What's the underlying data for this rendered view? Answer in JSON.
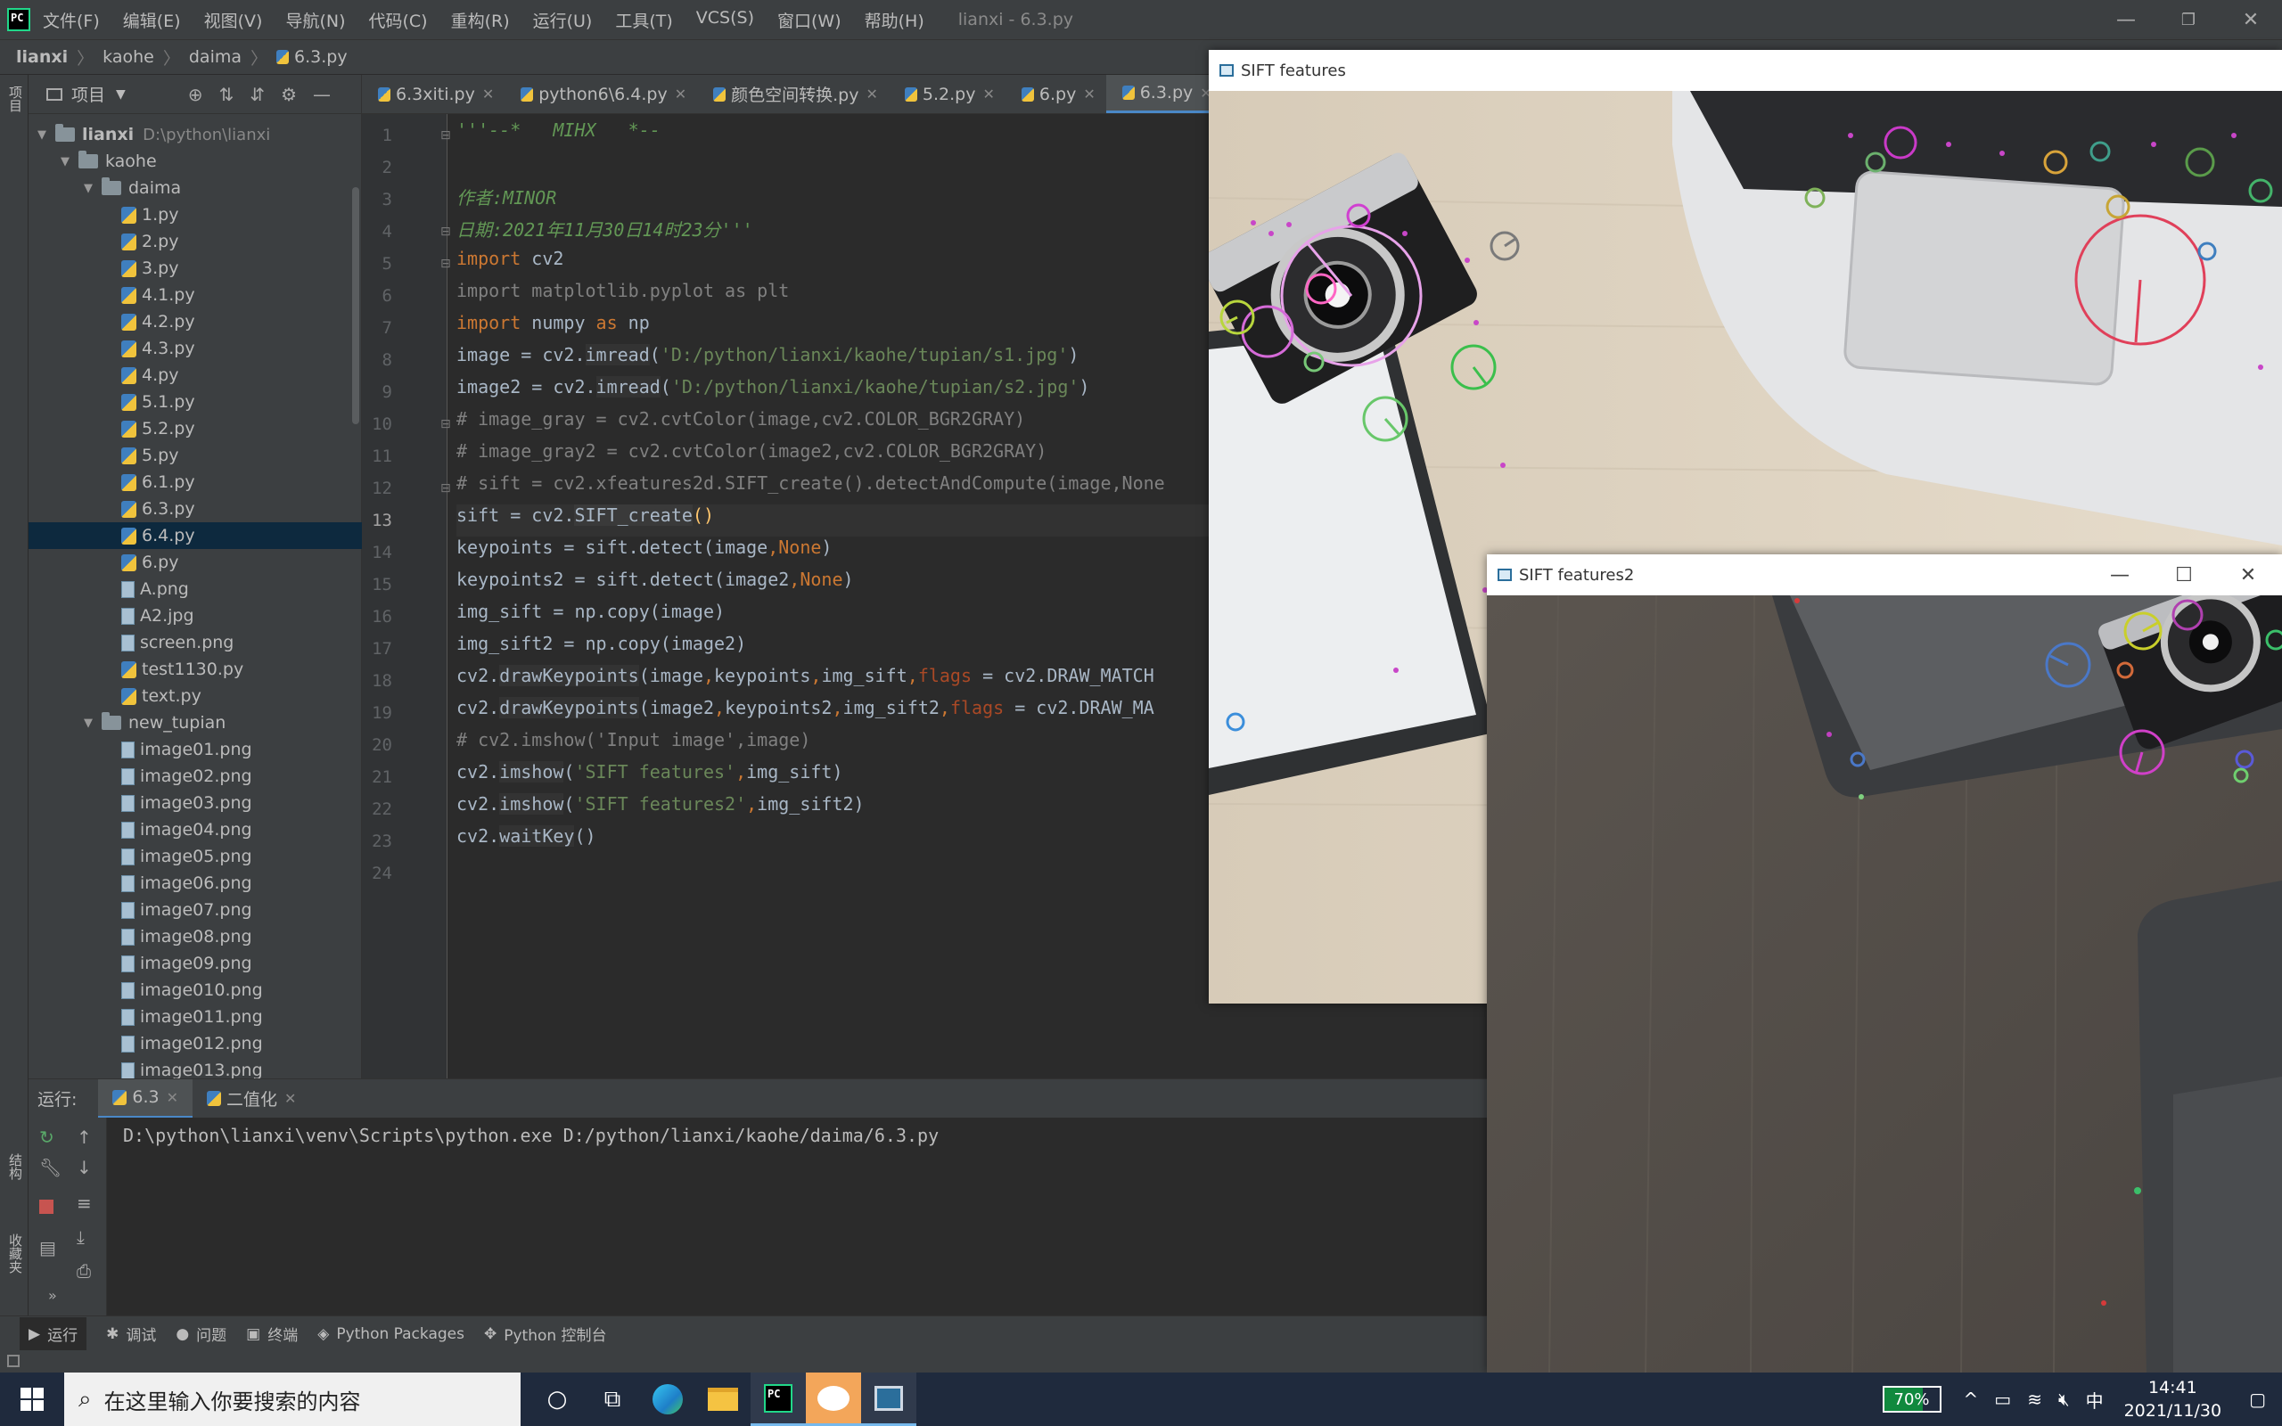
{
  "titlebar": {
    "menus": [
      "文件(F)",
      "编辑(E)",
      "视图(V)",
      "导航(N)",
      "代码(C)",
      "重构(R)",
      "运行(U)",
      "工具(T)",
      "VCS(S)",
      "窗口(W)",
      "帮助(H)"
    ],
    "title": "lianxi - 6.3.py",
    "minimize": "—",
    "maximize": "❐",
    "close": "✕"
  },
  "breadcrumb": [
    "lianxi",
    "kaohe",
    "daima",
    "6.3.py"
  ],
  "left_strip": {
    "project_label": "项目",
    "structure_label": "结构",
    "favorites_label": "收藏夹"
  },
  "project_panel": {
    "title": "项目",
    "root": "lianxi",
    "root_path": "D:\\python\\lianxi",
    "tree": [
      {
        "label": "lianxi",
        "depth": 0,
        "kind": "folder",
        "open": true
      },
      {
        "label": "kaohe",
        "depth": 1,
        "kind": "folder",
        "open": true
      },
      {
        "label": "daima",
        "depth": 2,
        "kind": "folder",
        "open": true
      },
      {
        "label": "1.py",
        "depth": 3,
        "kind": "py"
      },
      {
        "label": "2.py",
        "depth": 3,
        "kind": "py"
      },
      {
        "label": "3.py",
        "depth": 3,
        "kind": "py"
      },
      {
        "label": "4.1.py",
        "depth": 3,
        "kind": "py"
      },
      {
        "label": "4.2.py",
        "depth": 3,
        "kind": "py"
      },
      {
        "label": "4.3.py",
        "depth": 3,
        "kind": "py"
      },
      {
        "label": "4.py",
        "depth": 3,
        "kind": "py"
      },
      {
        "label": "5.1.py",
        "depth": 3,
        "kind": "py"
      },
      {
        "label": "5.2.py",
        "depth": 3,
        "kind": "py"
      },
      {
        "label": "5.py",
        "depth": 3,
        "kind": "py"
      },
      {
        "label": "6.1.py",
        "depth": 3,
        "kind": "py"
      },
      {
        "label": "6.3.py",
        "depth": 3,
        "kind": "py"
      },
      {
        "label": "6.4.py",
        "depth": 3,
        "kind": "py",
        "selected": true
      },
      {
        "label": "6.py",
        "depth": 3,
        "kind": "py"
      },
      {
        "label": "A.png",
        "depth": 3,
        "kind": "img"
      },
      {
        "label": "A2.jpg",
        "depth": 3,
        "kind": "img"
      },
      {
        "label": "screen.png",
        "depth": 3,
        "kind": "img"
      },
      {
        "label": "test1130.py",
        "depth": 3,
        "kind": "py"
      },
      {
        "label": "text.py",
        "depth": 3,
        "kind": "py"
      },
      {
        "label": "new_tupian",
        "depth": 2,
        "kind": "folder",
        "open": true
      },
      {
        "label": "image01.png",
        "depth": 3,
        "kind": "img"
      },
      {
        "label": "image02.png",
        "depth": 3,
        "kind": "img"
      },
      {
        "label": "image03.png",
        "depth": 3,
        "kind": "img"
      },
      {
        "label": "image04.png",
        "depth": 3,
        "kind": "img"
      },
      {
        "label": "image05.png",
        "depth": 3,
        "kind": "img"
      },
      {
        "label": "image06.png",
        "depth": 3,
        "kind": "img"
      },
      {
        "label": "image07.png",
        "depth": 3,
        "kind": "img"
      },
      {
        "label": "image08.png",
        "depth": 3,
        "kind": "img"
      },
      {
        "label": "image09.png",
        "depth": 3,
        "kind": "img"
      },
      {
        "label": "image010.png",
        "depth": 3,
        "kind": "img"
      },
      {
        "label": "image011.png",
        "depth": 3,
        "kind": "img"
      },
      {
        "label": "image012.png",
        "depth": 3,
        "kind": "img"
      },
      {
        "label": "image013.png",
        "depth": 3,
        "kind": "img"
      }
    ]
  },
  "editor": {
    "tabs": [
      {
        "label": "6.3xiti.py",
        "active": false
      },
      {
        "label": "python6\\6.4.py",
        "active": false
      },
      {
        "label": "颜色空间转换.py",
        "active": false
      },
      {
        "label": "5.2.py",
        "active": false
      },
      {
        "label": "6.py",
        "active": false
      },
      {
        "label": "6.3.py",
        "active": true
      }
    ],
    "current_line": 13,
    "lines": [
      [
        [
          "doc",
          "'''--*   MIHX   *--"
        ]
      ],
      [],
      [
        [
          "doc",
          "作者:MINOR"
        ]
      ],
      [
        [
          "doc",
          "日期:2021年11月30日14时23分'''"
        ]
      ],
      [
        [
          "kw",
          "import"
        ],
        [
          "",
          " cv2"
        ]
      ],
      [
        [
          "cm",
          "import matplotlib.pyplot as plt"
        ]
      ],
      [
        [
          "kw",
          "import"
        ],
        [
          "",
          " numpy "
        ],
        [
          "kw",
          "as"
        ],
        [
          "",
          " np"
        ]
      ],
      [
        [
          "",
          "image = cv2."
        ],
        [
          "fn",
          "imread"
        ],
        [
          "",
          "("
        ],
        [
          "str",
          "'D:/python/lianxi/kaohe/tupian/s1.jpg'"
        ],
        [
          "",
          ")"
        ]
      ],
      [
        [
          "",
          "image2 = cv2."
        ],
        [
          "fn",
          "imread"
        ],
        [
          "",
          "("
        ],
        [
          "str",
          "'D:/python/lianxi/kaohe/tupian/s2.jpg'"
        ],
        [
          "",
          ")"
        ]
      ],
      [
        [
          "cm",
          "# image_gray = cv2.cvtColor(image,cv2.COLOR_BGR2GRAY)"
        ]
      ],
      [
        [
          "cm",
          "# image_gray2 = cv2.cvtColor(image2,cv2.COLOR_BGR2GRAY)"
        ]
      ],
      [
        [
          "cm",
          "# sift = cv2.xfeatures2d.SIFT_create().detectAndCompute(image,None"
        ]
      ],
      [
        [
          "",
          "sift = cv2."
        ],
        [
          "fn",
          "SIFT_create"
        ],
        [
          "deco",
          "()"
        ]
      ],
      [
        [
          "",
          "keypoints = sift.detect(image"
        ],
        [
          "kw",
          ","
        ],
        [
          "none",
          "None"
        ],
        [
          "",
          ")"
        ]
      ],
      [
        [
          "",
          "keypoints2 = sift.detect(image2"
        ],
        [
          "kw",
          ","
        ],
        [
          "none",
          "None"
        ],
        [
          "",
          ")"
        ]
      ],
      [
        [
          "",
          "img_sift = np.copy(image)"
        ]
      ],
      [
        [
          "",
          "img_sift2 = np.copy(image2)"
        ]
      ],
      [
        [
          "",
          "cv2."
        ],
        [
          "fn",
          "drawKeypoints"
        ],
        [
          "",
          "(image"
        ],
        [
          "kw",
          ","
        ],
        [
          "",
          "keypoints"
        ],
        [
          "kw",
          ","
        ],
        [
          "",
          "img_sift"
        ],
        [
          "kw",
          ","
        ],
        [
          "param",
          "flags"
        ],
        [
          "",
          " = cv2.DRAW_MATCH"
        ]
      ],
      [
        [
          "",
          "cv2."
        ],
        [
          "fn",
          "drawKeypoints"
        ],
        [
          "",
          "(image2"
        ],
        [
          "kw",
          ","
        ],
        [
          "",
          "keypoints2"
        ],
        [
          "kw",
          ","
        ],
        [
          "",
          "img_sift2"
        ],
        [
          "kw",
          ","
        ],
        [
          "param",
          "flags"
        ],
        [
          "",
          " = cv2.DRAW_MA"
        ]
      ],
      [
        [
          "cm",
          "# cv2.imshow('Input image',image)"
        ]
      ],
      [
        [
          "",
          "cv2."
        ],
        [
          "fn",
          "imshow"
        ],
        [
          "",
          "("
        ],
        [
          "str",
          "'SIFT features'"
        ],
        [
          "kw",
          ","
        ],
        [
          "",
          "img_sift)"
        ]
      ],
      [
        [
          "",
          "cv2."
        ],
        [
          "fn",
          "imshow"
        ],
        [
          "",
          "("
        ],
        [
          "str",
          "'SIFT features2'"
        ],
        [
          "kw",
          ","
        ],
        [
          "",
          "img_sift2)"
        ]
      ],
      [
        [
          "",
          "cv2."
        ],
        [
          "fn",
          "waitKey"
        ],
        [
          "",
          "()"
        ]
      ],
      []
    ]
  },
  "run_panel": {
    "label": "运行:",
    "tabs": [
      {
        "label": "6.3",
        "active": true
      },
      {
        "label": "二值化",
        "active": false
      }
    ],
    "output": "D:\\python\\lianxi\\venv\\Scripts\\python.exe D:/python/lianxi/kaohe/daima/6.3.py"
  },
  "bottom_tools": [
    "运行",
    "调试",
    "问题",
    "终端",
    "Python Packages",
    "Python 控制台"
  ],
  "cv_windows": [
    {
      "title": "SIFT features"
    },
    {
      "title": "SIFT features2",
      "minimize": "—",
      "maximize": "☐",
      "close": "✕"
    }
  ],
  "taskbar": {
    "search_placeholder": "在这里输入你要搜索的内容",
    "battery": "70%",
    "battery_level": 0.7,
    "ime": "中",
    "time": "14:41",
    "date": "2021/11/30"
  }
}
